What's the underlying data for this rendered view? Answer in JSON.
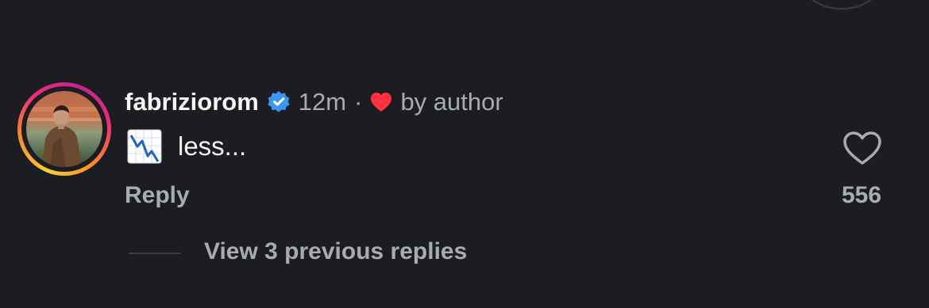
{
  "comment": {
    "username": "fabriziorom",
    "time": "12m",
    "separator": "·",
    "liked_label": "by author",
    "text": "less...",
    "reply_label": "Reply",
    "like_count": "556",
    "view_replies_label": "View 3 previous replies"
  },
  "icons": {
    "verified": "verified-badge-icon",
    "liked": "heart-filled-icon",
    "emoji": "chart-decreasing-icon",
    "like": "heart-outline-icon"
  },
  "colors": {
    "background": "#1b1d21",
    "verified": "#3897f0",
    "liked_heart": "#ff3040",
    "muted_text": "#a8abb2"
  }
}
